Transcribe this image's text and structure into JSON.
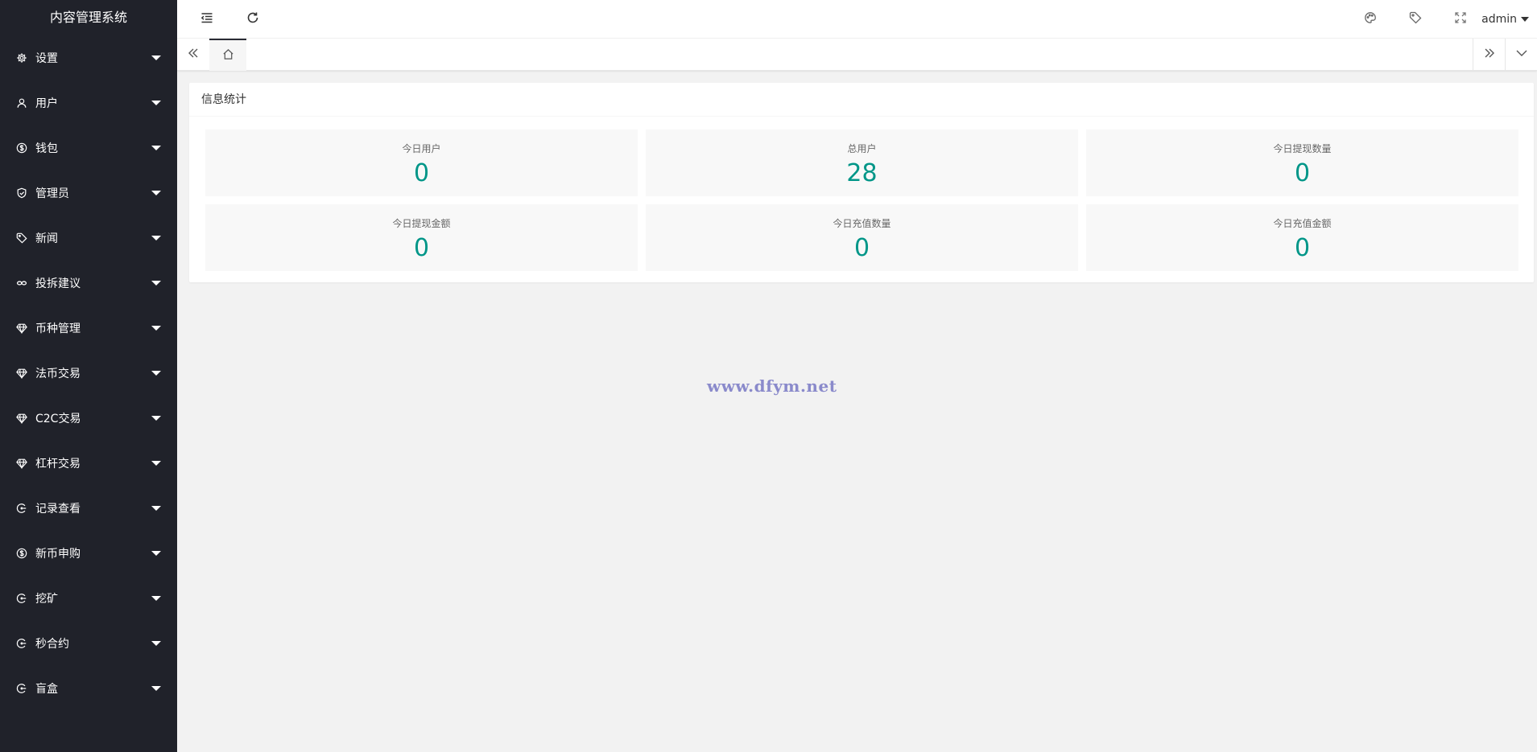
{
  "app": {
    "title": "内容管理系统"
  },
  "sidebar": {
    "items": [
      {
        "label": "设置",
        "icon": "gear-icon"
      },
      {
        "label": "用户",
        "icon": "user-icon"
      },
      {
        "label": "钱包",
        "icon": "dollar-icon"
      },
      {
        "label": "管理员",
        "icon": "shield-icon"
      },
      {
        "label": "新闻",
        "icon": "tag-icon"
      },
      {
        "label": "投拆建议",
        "icon": "link-icon"
      },
      {
        "label": "币种管理",
        "icon": "diamond-icon"
      },
      {
        "label": "法币交易",
        "icon": "diamond-icon"
      },
      {
        "label": "C2C交易",
        "icon": "diamond-icon"
      },
      {
        "label": "杠杆交易",
        "icon": "diamond-icon"
      },
      {
        "label": "记录查看",
        "icon": "cycle-icon"
      },
      {
        "label": "新币申购",
        "icon": "dollar-icon"
      },
      {
        "label": "挖矿",
        "icon": "cycle-icon"
      },
      {
        "label": "秒合约",
        "icon": "cycle-icon"
      },
      {
        "label": "盲盒",
        "icon": "cycle-icon"
      }
    ]
  },
  "header": {
    "user": "admin"
  },
  "card": {
    "title": "信息统计",
    "stats": [
      {
        "label": "今日用户",
        "value": "0"
      },
      {
        "label": "总用户",
        "value": "28"
      },
      {
        "label": "今日提现数量",
        "value": "0"
      },
      {
        "label": "今日提现金额",
        "value": "0"
      },
      {
        "label": "今日充值数量",
        "value": "0"
      },
      {
        "label": "今日充值金额",
        "value": "0"
      }
    ]
  },
  "watermark": "www.dfym.net",
  "colors": {
    "sidebar_bg": "#20222a",
    "accent": "#009688",
    "page_bg": "#f2f2f2"
  }
}
